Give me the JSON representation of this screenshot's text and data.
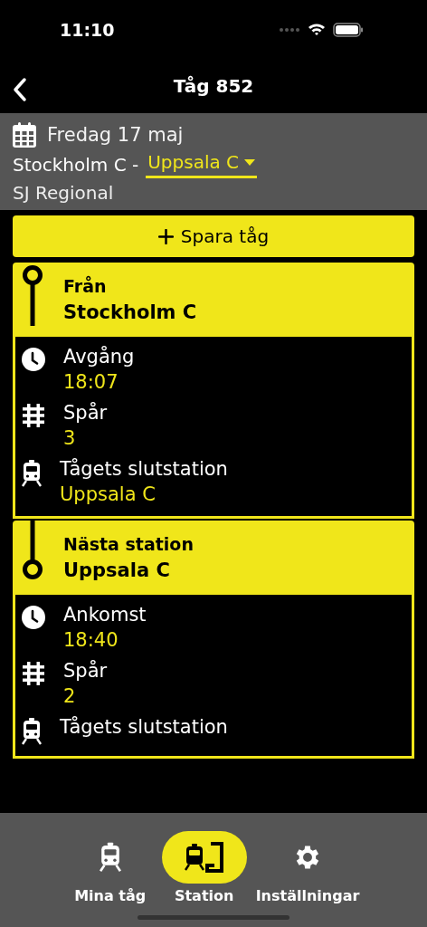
{
  "status_bar": {
    "time": "11:10"
  },
  "nav": {
    "title": "Tåg 852"
  },
  "header": {
    "date": "Fredag 17 maj",
    "origin": "Stockholm C -",
    "destination": "Uppsala C",
    "operator": "SJ Regional"
  },
  "save_button": {
    "label": "Spara tåg"
  },
  "stops": [
    {
      "kind": "origin",
      "label": "Från",
      "station": "Stockholm C",
      "details": [
        {
          "kind": "time",
          "label": "Avgång",
          "value": "18:07"
        },
        {
          "kind": "track",
          "label": "Spår",
          "value": "3"
        },
        {
          "kind": "terminus",
          "label": "Tågets slutstation",
          "value": "Uppsala C"
        }
      ]
    },
    {
      "kind": "next",
      "label": "Nästa station",
      "station": "Uppsala C",
      "details": [
        {
          "kind": "time",
          "label": "Ankomst",
          "value": "18:40"
        },
        {
          "kind": "track",
          "label": "Spår",
          "value": "2"
        },
        {
          "kind": "terminus",
          "label": "Tågets slutstation"
        }
      ]
    }
  ],
  "tabs": [
    {
      "kind": "trains",
      "label": "Mina tåg",
      "selected": false
    },
    {
      "kind": "station",
      "label": "Station",
      "selected": true
    },
    {
      "kind": "settings",
      "label": "Inställningar",
      "selected": false
    }
  ]
}
